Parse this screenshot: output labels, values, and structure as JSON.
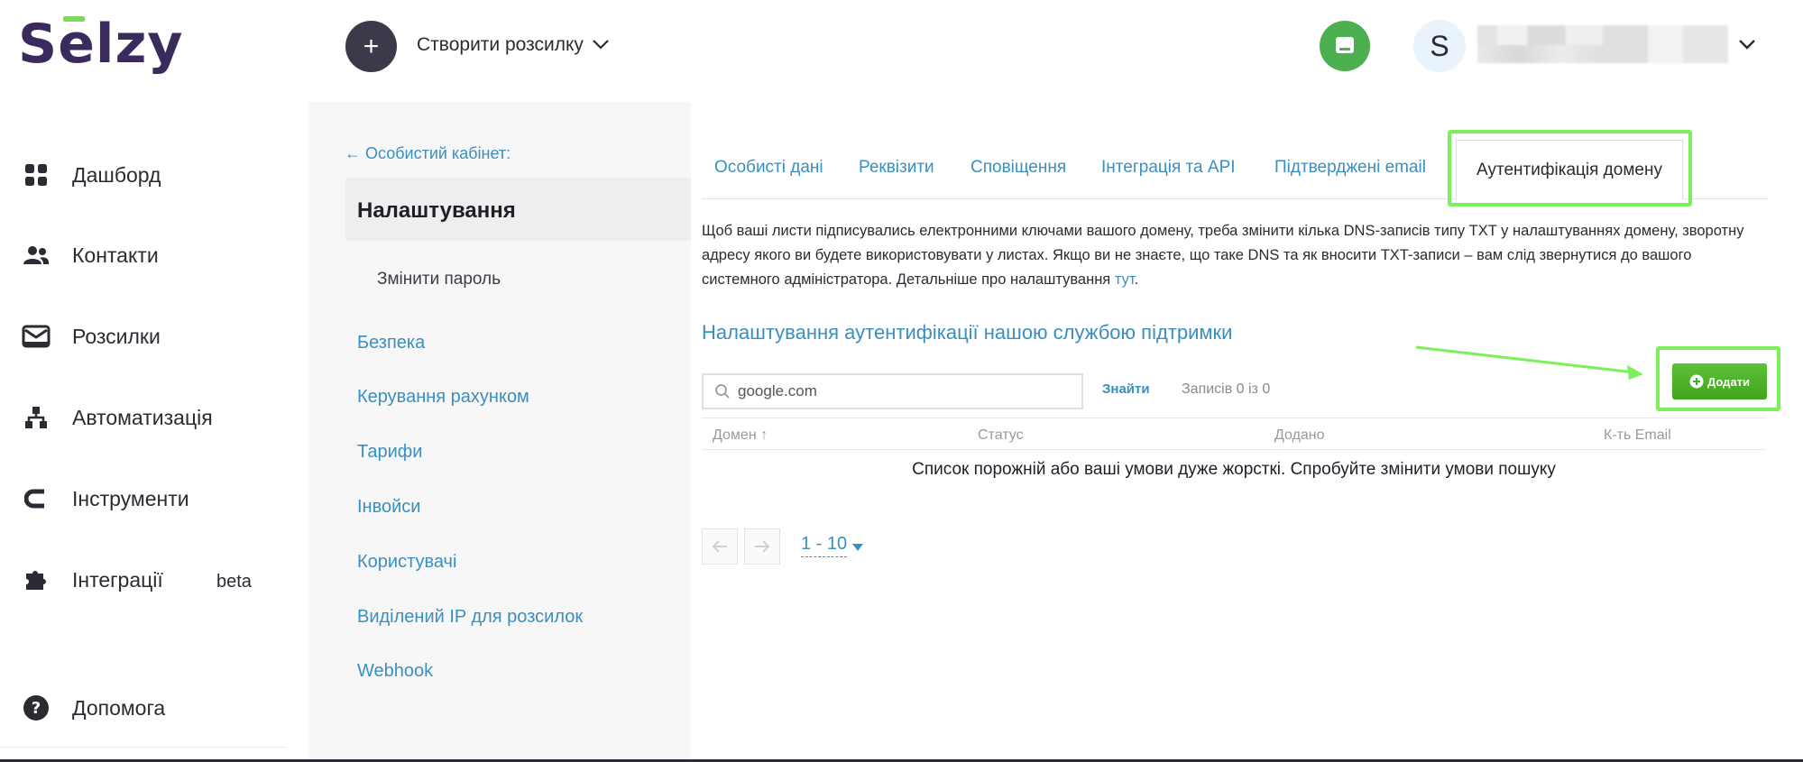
{
  "app": {
    "logo_text_1": "S",
    "logo_text_2": "e",
    "logo_text_3": "lzy",
    "accent_green": "#7ed957",
    "link_color": "#3a8fc1"
  },
  "header": {
    "create_icon": "plus-icon",
    "create_label": "Створити розсилку",
    "chat_icon": "chat-icon",
    "avatar_letter": "S"
  },
  "sidebar": {
    "items": [
      {
        "label": "Дашборд",
        "icon": "dashboard-icon"
      },
      {
        "label": "Контакти",
        "icon": "contacts-icon"
      },
      {
        "label": "Розсилки",
        "icon": "mail-icon"
      },
      {
        "label": "Автоматизація",
        "icon": "automation-icon"
      },
      {
        "label": "Інструменти",
        "icon": "tools-icon"
      },
      {
        "label": "Інтеграції",
        "icon": "puzzle-icon",
        "badge": "beta"
      },
      {
        "label": "Допомога",
        "icon": "help-icon"
      }
    ]
  },
  "settings_nav": {
    "back_link": "← Особистий кабінет:",
    "title": "Налаштування",
    "change_password": "Змінити пароль",
    "links": [
      "Безпека",
      "Керування рахунком",
      "Тарифи",
      "Інвойси",
      "Користувачі",
      "Виділений IP для розсилок",
      "Webhook"
    ]
  },
  "tabs": [
    {
      "label": "Особисті дані"
    },
    {
      "label": "Реквізити"
    },
    {
      "label": "Сповіщення"
    },
    {
      "label": "Інтеграція та API"
    },
    {
      "label": "Підтверджені email"
    },
    {
      "label": "Аутентифікація домену",
      "active": true
    }
  ],
  "content": {
    "description": "Щоб ваші листи підписувались електронними ключами вашого домену, треба змінити кілька DNS-записів типу TXT у налаштуваннях домену, зворотну адресу якого ви будете використовувати у листах. Якщо ви не знаєте, що таке DNS та як вносити TXT-записи – вам слід звернутися до вашого системного адміністратора. Детальніше про налаштування ",
    "description_link": "тут",
    "description_end": ".",
    "section_title": "Налаштування аутентифікації нашою службою підтримки",
    "search_placeholder": "google.com",
    "find_label": "Знайти",
    "records_label": "Записів 0 із 0",
    "add_label": "Додати",
    "table_headers": [
      "Домен ↑",
      "Статус",
      "Додано",
      "К-ть Email"
    ],
    "empty_message": "Список порожній або ваші умови дуже жорсткі. Спробуйте змінити умови пошуку",
    "per_page": "1 - 10"
  }
}
